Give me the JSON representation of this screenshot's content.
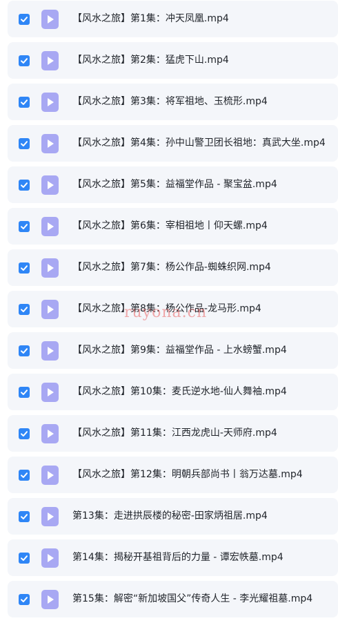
{
  "colors": {
    "checkbox": "#2f86f6",
    "icon": "#a8a8f3",
    "row_background": "#f4f6fa",
    "text": "#1f2329"
  },
  "row_icons": {
    "checkbox": "checkbox-checked-icon",
    "file": "video-file-icon"
  },
  "files": [
    {
      "name": "【风水之旅】第1集：冲天凤凰.mp4",
      "checked": true
    },
    {
      "name": "【风水之旅】第2集：猛虎下山.mp4",
      "checked": true
    },
    {
      "name": "【风水之旅】第3集：将军祖地、玉梳形.mp4",
      "checked": true
    },
    {
      "name": "【风水之旅】第4集：孙中山警卫团长祖地：真武大坐.mp4",
      "checked": true
    },
    {
      "name": "【风水之旅】第5集：益福堂作品 - 聚宝盆.mp4",
      "checked": true
    },
    {
      "name": "【风水之旅】第6集：宰相祖地丨仰天螺.mp4",
      "checked": true
    },
    {
      "name": "【风水之旅】第7集：杨公作品-蜘蛛织网.mp4",
      "checked": true
    },
    {
      "name": "【风水之旅】第8集：杨公作品-龙马形.mp4",
      "checked": true
    },
    {
      "name": "【风水之旅】第9集：益福堂作品 - 上水螃蟹.mp4",
      "checked": true
    },
    {
      "name": "【风水之旅】第10集：麦氏逆水地-仙人舞袖.mp4",
      "checked": true
    },
    {
      "name": "【风水之旅】第11集：江西龙虎山-天师府.mp4",
      "checked": true
    },
    {
      "name": "【风水之旅】第12集：明朝兵部尚书丨翁万达墓.mp4",
      "checked": true
    },
    {
      "name": "第13集：走进拱辰楼的秘密-田家炳祖居.mp4",
      "checked": true
    },
    {
      "name": "第14集：揭秘开基祖背后的力量 - 谭宏帙墓.mp4",
      "checked": true
    },
    {
      "name": "第15集：解密“新加坡国父”传奇人生 - 李光耀祖墓.mp4",
      "checked": true
    }
  ],
  "watermark": "ruyona.cn"
}
